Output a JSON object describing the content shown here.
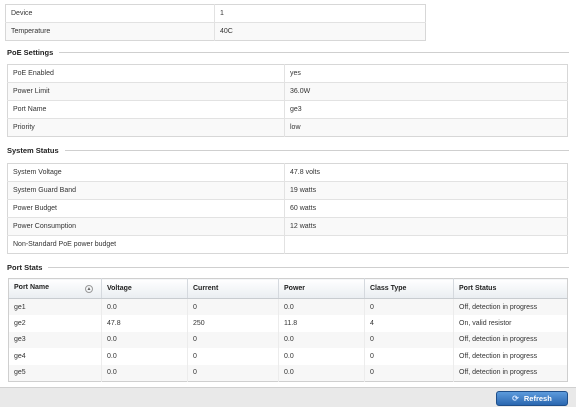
{
  "top_table": [
    {
      "label": "Device",
      "value": "1"
    },
    {
      "label": "Temperature",
      "value": "40C"
    }
  ],
  "poe_settings": {
    "title": "PoE Settings",
    "rows": [
      {
        "label": "PoE Enabled",
        "value": "yes"
      },
      {
        "label": "Power Limit",
        "value": "36.0W"
      },
      {
        "label": "Port Name",
        "value": "ge3"
      },
      {
        "label": "Priority",
        "value": "low"
      }
    ]
  },
  "system_status": {
    "title": "System Status",
    "rows": [
      {
        "label": "System Voltage",
        "value": "47.8 volts"
      },
      {
        "label": "System Guard Band",
        "value": "19 watts"
      },
      {
        "label": "Power Budget",
        "value": "60 watts"
      },
      {
        "label": "Power Consumption",
        "value": "12 watts"
      },
      {
        "label": "Non-Standard PoE power budget",
        "value": ""
      }
    ]
  },
  "port_stats": {
    "title": "Port Stats",
    "columns": [
      "Port Name",
      "Voltage",
      "Current",
      "Power",
      "Class Type",
      "Port Status"
    ],
    "rows": [
      [
        "ge1",
        "0.0",
        "0",
        "0.0",
        "0",
        "Off, detection in progress"
      ],
      [
        "ge2",
        "47.8",
        "250",
        "11.8",
        "4",
        "On, valid resistor"
      ],
      [
        "ge3",
        "0.0",
        "0",
        "0.0",
        "0",
        "Off, detection in progress"
      ],
      [
        "ge4",
        "0.0",
        "0",
        "0.0",
        "0",
        "Off, detection in progress"
      ],
      [
        "ge5",
        "0.0",
        "0",
        "0.0",
        "0",
        "Off, detection in progress"
      ]
    ]
  },
  "footer": {
    "refresh_label": "Refresh"
  }
}
